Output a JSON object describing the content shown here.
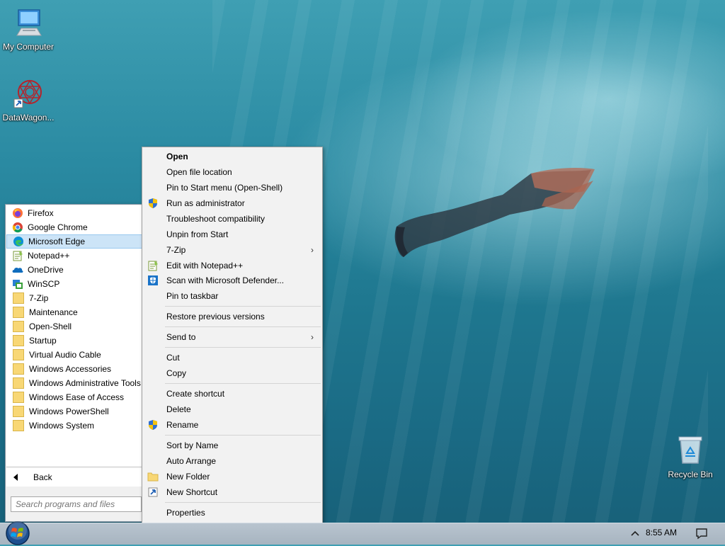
{
  "desktop": {
    "icons": [
      {
        "label": "My Computer",
        "icon": "monitor-icon"
      },
      {
        "label": "DataWagon...",
        "icon": "datawagon-logo-icon"
      },
      {
        "label": "Recycle Bin",
        "icon": "recycle-bin-icon"
      }
    ]
  },
  "start_menu": {
    "programs": [
      {
        "label": "Firefox",
        "icon": "firefox-icon"
      },
      {
        "label": "Google Chrome",
        "icon": "chrome-icon"
      },
      {
        "label": "Microsoft Edge",
        "icon": "edge-icon",
        "selected": true
      },
      {
        "label": "Notepad++",
        "icon": "notepadpp-icon"
      },
      {
        "label": "OneDrive",
        "icon": "onedrive-icon"
      },
      {
        "label": "WinSCP",
        "icon": "winscp-icon"
      },
      {
        "label": "7-Zip",
        "icon": "folder-icon"
      },
      {
        "label": "Maintenance",
        "icon": "folder-icon"
      },
      {
        "label": "Open-Shell",
        "icon": "folder-icon"
      },
      {
        "label": "Startup",
        "icon": "folder-icon"
      },
      {
        "label": "Virtual Audio Cable",
        "icon": "folder-icon"
      },
      {
        "label": "Windows Accessories",
        "icon": "folder-icon"
      },
      {
        "label": "Windows Administrative Tools",
        "icon": "folder-icon"
      },
      {
        "label": "Windows Ease of Access",
        "icon": "folder-icon"
      },
      {
        "label": "Windows PowerShell",
        "icon": "folder-icon"
      },
      {
        "label": "Windows System",
        "icon": "folder-icon"
      }
    ],
    "back_label": "Back",
    "search_placeholder": "Search programs and files"
  },
  "context_menu": {
    "items": [
      {
        "label": "Open",
        "bold": true
      },
      {
        "label": "Open file location"
      },
      {
        "label": "Pin to Start menu (Open-Shell)"
      },
      {
        "label": "Run as administrator",
        "icon": "uac-shield-icon"
      },
      {
        "label": "Troubleshoot compatibility"
      },
      {
        "label": "Unpin from Start"
      },
      {
        "label": "7-Zip",
        "submenu": true
      },
      {
        "label": "Edit with Notepad++",
        "icon": "notepadpp-icon"
      },
      {
        "label": "Scan with Microsoft Defender...",
        "icon": "defender-icon"
      },
      {
        "label": "Pin to taskbar"
      },
      {
        "label": "Restore previous versions"
      },
      {
        "label": "Send to",
        "submenu": true
      },
      {
        "label": "Cut"
      },
      {
        "label": "Copy"
      },
      {
        "label": "Create shortcut"
      },
      {
        "label": "Delete"
      },
      {
        "label": "Rename",
        "icon": "uac-shield-icon"
      },
      {
        "label": "Sort by Name"
      },
      {
        "label": "Auto Arrange"
      },
      {
        "label": "New Folder",
        "icon": "folder-icon"
      },
      {
        "label": "New Shortcut",
        "icon": "shortcut-icon"
      },
      {
        "label": "Properties"
      }
    ],
    "submenu_glyph": "›"
  },
  "taskbar": {
    "clock": "8:55 AM"
  }
}
